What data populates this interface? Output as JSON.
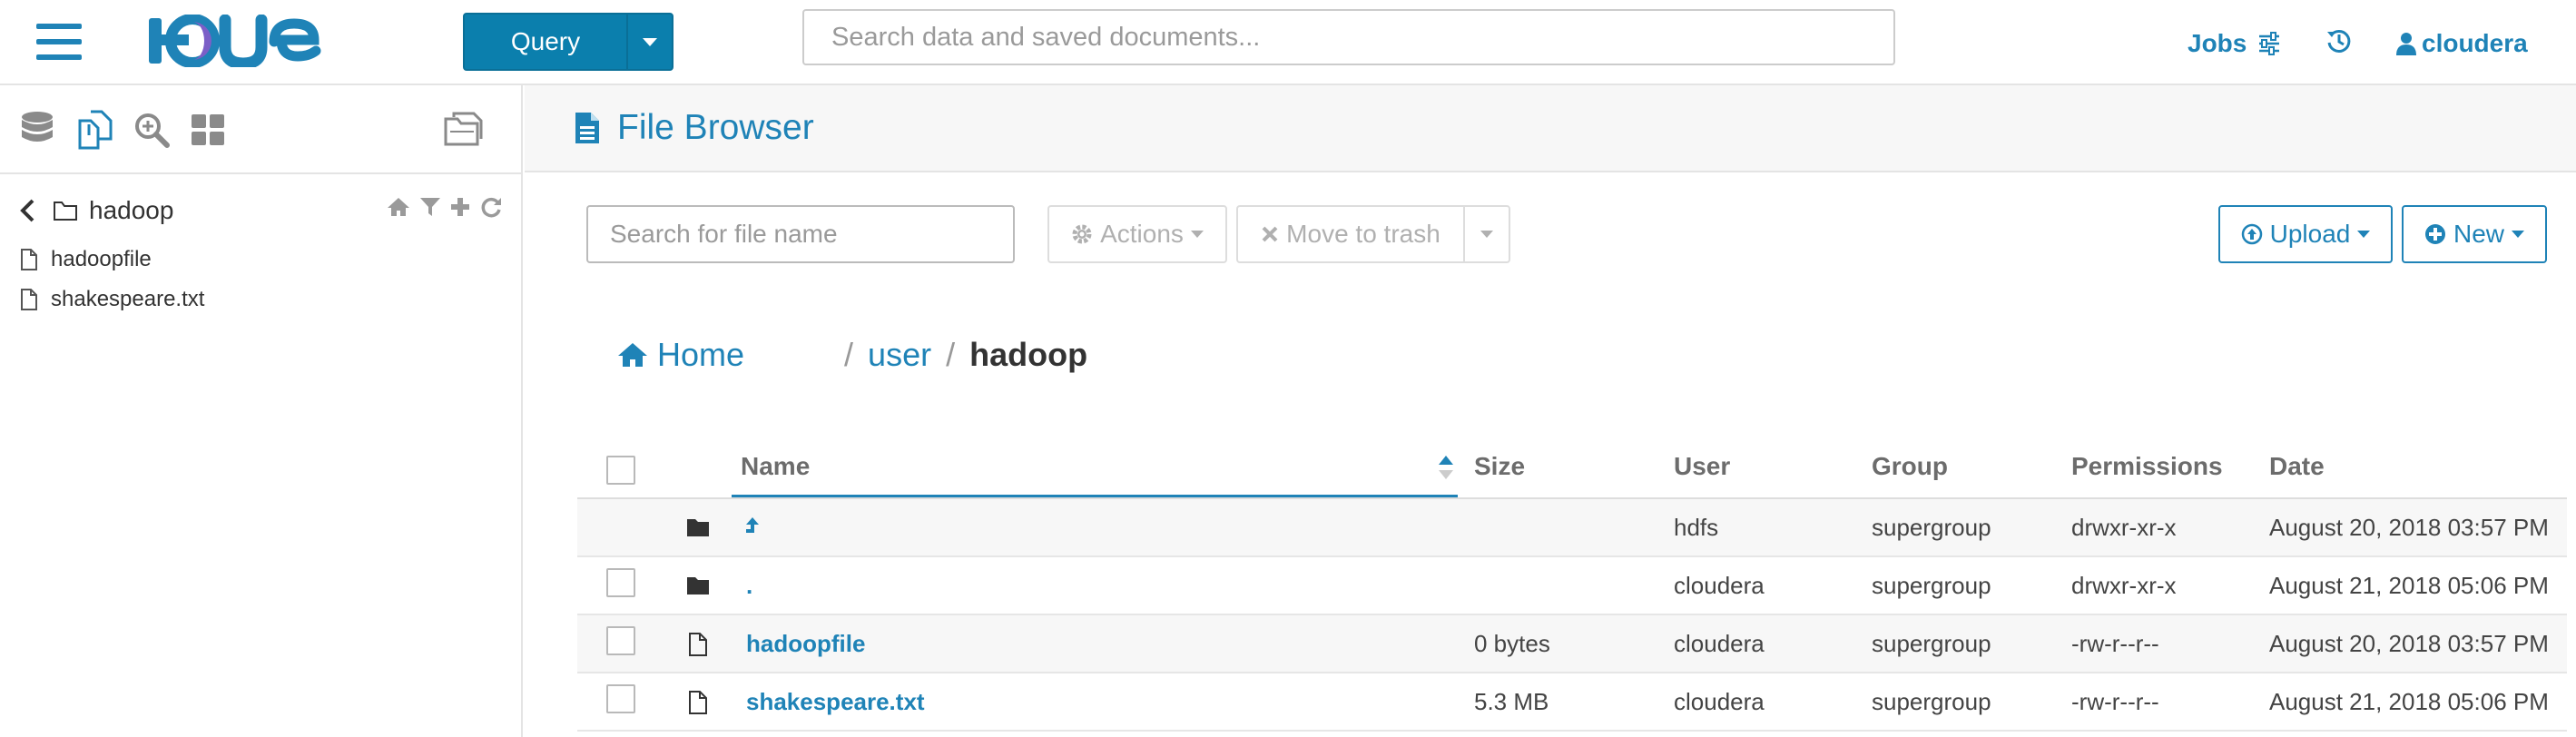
{
  "topbar": {
    "logo_text": "HUE",
    "query_label": "Query",
    "search_placeholder": "Search data and saved documents...",
    "jobs_label": "Jobs",
    "user_label": "cloudera"
  },
  "leftpanel": {
    "current_dir": "hadoop",
    "files": [
      "hadoopfile",
      "shakespeare.txt"
    ]
  },
  "main": {
    "title": "File Browser",
    "file_search_placeholder": "Search for file name",
    "actions_label": "Actions",
    "trash_label": "Move to trash",
    "upload_label": "Upload",
    "new_label": "New",
    "breadcrumb": {
      "home": "Home",
      "sep1": "/",
      "user": "user",
      "sep2": "/",
      "current": "hadoop"
    },
    "columns": {
      "name": "Name",
      "size": "Size",
      "user": "User",
      "group": "Group",
      "permissions": "Permissions",
      "date": "Date"
    },
    "rows": [
      {
        "type": "folder",
        "name": "",
        "icon": "level-up-icon",
        "size": "",
        "user": "hdfs",
        "group": "supergroup",
        "permissions": "drwxr-xr-x",
        "date": "August 20, 2018 03:57 PM",
        "selectable": false
      },
      {
        "type": "folder",
        "name": ".",
        "size": "",
        "user": "cloudera",
        "group": "supergroup",
        "permissions": "drwxr-xr-x",
        "date": "August 21, 2018 05:06 PM",
        "selectable": true
      },
      {
        "type": "file",
        "name": "hadoopfile",
        "size": "0 bytes",
        "user": "cloudera",
        "group": "supergroup",
        "permissions": "-rw-r--r--",
        "date": "August 20, 2018 03:57 PM",
        "selectable": true
      },
      {
        "type": "file",
        "name": "shakespeare.txt",
        "size": "5.3 MB",
        "user": "cloudera",
        "group": "supergroup",
        "permissions": "-rw-r--r--",
        "date": "August 21, 2018 05:06 PM",
        "selectable": true
      }
    ]
  },
  "colors": {
    "accent": "#1f83b7",
    "query_button": "#0b7fad",
    "border": "#dddddd"
  }
}
